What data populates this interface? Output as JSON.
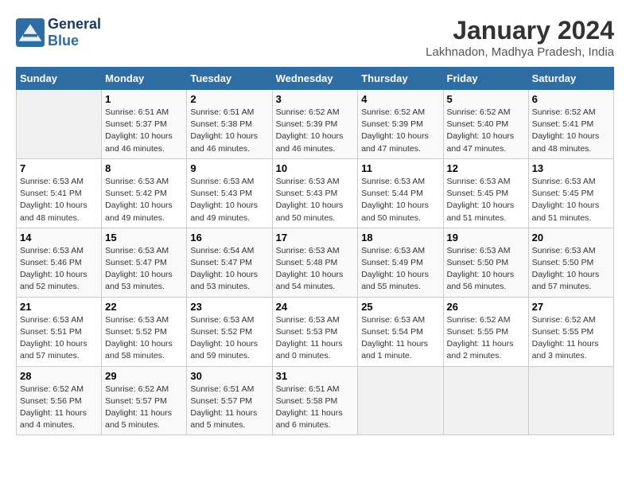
{
  "header": {
    "logo_general": "General",
    "logo_blue": "Blue",
    "month_title": "January 2024",
    "location": "Lakhnadon, Madhya Pradesh, India"
  },
  "days_of_week": [
    "Sunday",
    "Monday",
    "Tuesday",
    "Wednesday",
    "Thursday",
    "Friday",
    "Saturday"
  ],
  "weeks": [
    [
      {
        "day": "",
        "info": ""
      },
      {
        "day": "1",
        "info": "Sunrise: 6:51 AM\nSunset: 5:37 PM\nDaylight: 10 hours\nand 46 minutes."
      },
      {
        "day": "2",
        "info": "Sunrise: 6:51 AM\nSunset: 5:38 PM\nDaylight: 10 hours\nand 46 minutes."
      },
      {
        "day": "3",
        "info": "Sunrise: 6:52 AM\nSunset: 5:39 PM\nDaylight: 10 hours\nand 46 minutes."
      },
      {
        "day": "4",
        "info": "Sunrise: 6:52 AM\nSunset: 5:39 PM\nDaylight: 10 hours\nand 47 minutes."
      },
      {
        "day": "5",
        "info": "Sunrise: 6:52 AM\nSunset: 5:40 PM\nDaylight: 10 hours\nand 47 minutes."
      },
      {
        "day": "6",
        "info": "Sunrise: 6:52 AM\nSunset: 5:41 PM\nDaylight: 10 hours\nand 48 minutes."
      }
    ],
    [
      {
        "day": "7",
        "info": "Sunrise: 6:53 AM\nSunset: 5:41 PM\nDaylight: 10 hours\nand 48 minutes."
      },
      {
        "day": "8",
        "info": "Sunrise: 6:53 AM\nSunset: 5:42 PM\nDaylight: 10 hours\nand 49 minutes."
      },
      {
        "day": "9",
        "info": "Sunrise: 6:53 AM\nSunset: 5:43 PM\nDaylight: 10 hours\nand 49 minutes."
      },
      {
        "day": "10",
        "info": "Sunrise: 6:53 AM\nSunset: 5:43 PM\nDaylight: 10 hours\nand 50 minutes."
      },
      {
        "day": "11",
        "info": "Sunrise: 6:53 AM\nSunset: 5:44 PM\nDaylight: 10 hours\nand 50 minutes."
      },
      {
        "day": "12",
        "info": "Sunrise: 6:53 AM\nSunset: 5:45 PM\nDaylight: 10 hours\nand 51 minutes."
      },
      {
        "day": "13",
        "info": "Sunrise: 6:53 AM\nSunset: 5:45 PM\nDaylight: 10 hours\nand 51 minutes."
      }
    ],
    [
      {
        "day": "14",
        "info": "Sunrise: 6:53 AM\nSunset: 5:46 PM\nDaylight: 10 hours\nand 52 minutes."
      },
      {
        "day": "15",
        "info": "Sunrise: 6:53 AM\nSunset: 5:47 PM\nDaylight: 10 hours\nand 53 minutes."
      },
      {
        "day": "16",
        "info": "Sunrise: 6:54 AM\nSunset: 5:47 PM\nDaylight: 10 hours\nand 53 minutes."
      },
      {
        "day": "17",
        "info": "Sunrise: 6:53 AM\nSunset: 5:48 PM\nDaylight: 10 hours\nand 54 minutes."
      },
      {
        "day": "18",
        "info": "Sunrise: 6:53 AM\nSunset: 5:49 PM\nDaylight: 10 hours\nand 55 minutes."
      },
      {
        "day": "19",
        "info": "Sunrise: 6:53 AM\nSunset: 5:50 PM\nDaylight: 10 hours\nand 56 minutes."
      },
      {
        "day": "20",
        "info": "Sunrise: 6:53 AM\nSunset: 5:50 PM\nDaylight: 10 hours\nand 57 minutes."
      }
    ],
    [
      {
        "day": "21",
        "info": "Sunrise: 6:53 AM\nSunset: 5:51 PM\nDaylight: 10 hours\nand 57 minutes."
      },
      {
        "day": "22",
        "info": "Sunrise: 6:53 AM\nSunset: 5:52 PM\nDaylight: 10 hours\nand 58 minutes."
      },
      {
        "day": "23",
        "info": "Sunrise: 6:53 AM\nSunset: 5:52 PM\nDaylight: 10 hours\nand 59 minutes."
      },
      {
        "day": "24",
        "info": "Sunrise: 6:53 AM\nSunset: 5:53 PM\nDaylight: 11 hours\nand 0 minutes."
      },
      {
        "day": "25",
        "info": "Sunrise: 6:53 AM\nSunset: 5:54 PM\nDaylight: 11 hours\nand 1 minute."
      },
      {
        "day": "26",
        "info": "Sunrise: 6:52 AM\nSunset: 5:55 PM\nDaylight: 11 hours\nand 2 minutes."
      },
      {
        "day": "27",
        "info": "Sunrise: 6:52 AM\nSunset: 5:55 PM\nDaylight: 11 hours\nand 3 minutes."
      }
    ],
    [
      {
        "day": "28",
        "info": "Sunrise: 6:52 AM\nSunset: 5:56 PM\nDaylight: 11 hours\nand 4 minutes."
      },
      {
        "day": "29",
        "info": "Sunrise: 6:52 AM\nSunset: 5:57 PM\nDaylight: 11 hours\nand 5 minutes."
      },
      {
        "day": "30",
        "info": "Sunrise: 6:51 AM\nSunset: 5:57 PM\nDaylight: 11 hours\nand 5 minutes."
      },
      {
        "day": "31",
        "info": "Sunrise: 6:51 AM\nSunset: 5:58 PM\nDaylight: 11 hours\nand 6 minutes."
      },
      {
        "day": "",
        "info": ""
      },
      {
        "day": "",
        "info": ""
      },
      {
        "day": "",
        "info": ""
      }
    ]
  ]
}
